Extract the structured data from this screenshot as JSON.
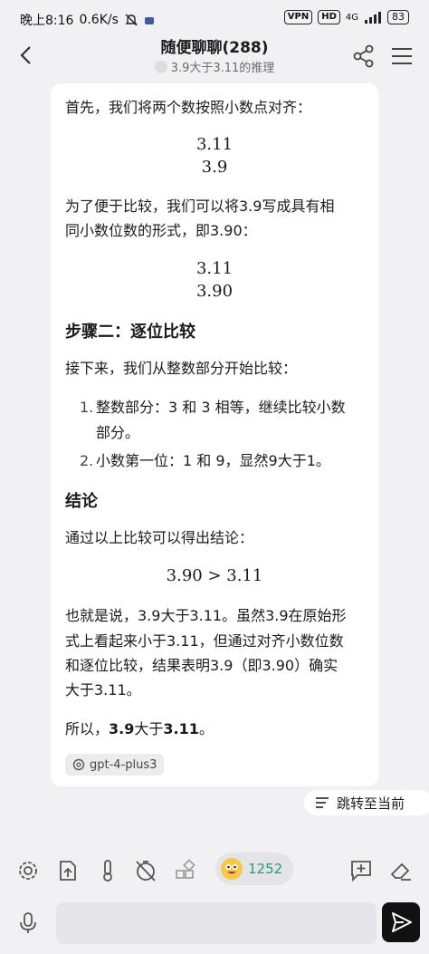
{
  "status_bar": {
    "time": "晚上8:16",
    "speed": "0.6K/s",
    "vpn": "VPN",
    "hd": "HD",
    "network": "4G",
    "battery": "83"
  },
  "header": {
    "title": "随便聊聊(288)",
    "subtitle": "3.9大于3.11的推理"
  },
  "message": {
    "p1": "首先，我们将两个数按照小数点对齐：",
    "math1_a": "3.11",
    "math1_b": "3.9",
    "p2_line1": "为了便于比较，我们可以将3.9写成具有相",
    "p2_line2": "同小数位数的形式，即3.90：",
    "math2_a": "3.11",
    "math2_b": "3.90",
    "h_step2": "步骤二：逐位比较",
    "p3": "接下来，我们从整数部分开始比较：",
    "list": [
      {
        "num": "1.",
        "line1": "整数部分：3 和 3 相等，继续比较小数",
        "line2": "部分。"
      },
      {
        "num": "2.",
        "line1": "小数第一位：1 和 9，显然9大于1。",
        "line2": ""
      }
    ],
    "h_conclusion": "结论",
    "p4": "通过以上比较可以得出结论：",
    "math3": "3.90 > 3.11",
    "p5_lines": [
      "也就是说，3.9大于3.11。虽然3.9在原始形",
      "式上看起来小于3.11，但通过对齐小数位数",
      "和逐位比较，结果表明3.9（即3.90）确实",
      "大于3.11。"
    ],
    "final_prefix": "所以，",
    "final_a": "3.9",
    "final_mid": "大于",
    "final_b": "3.11",
    "final_suffix": "。",
    "model_tag": "gpt-4-plus3"
  },
  "jump_label": "跳转至当前",
  "toolbar": {
    "credits": "1252",
    "icons": [
      "settings-icon",
      "upload-icon",
      "thermometer-icon",
      "timer-off-icon",
      "widgets-icon",
      "add-comment-icon",
      "eraser-icon"
    ]
  },
  "input": {
    "placeholder": ""
  }
}
